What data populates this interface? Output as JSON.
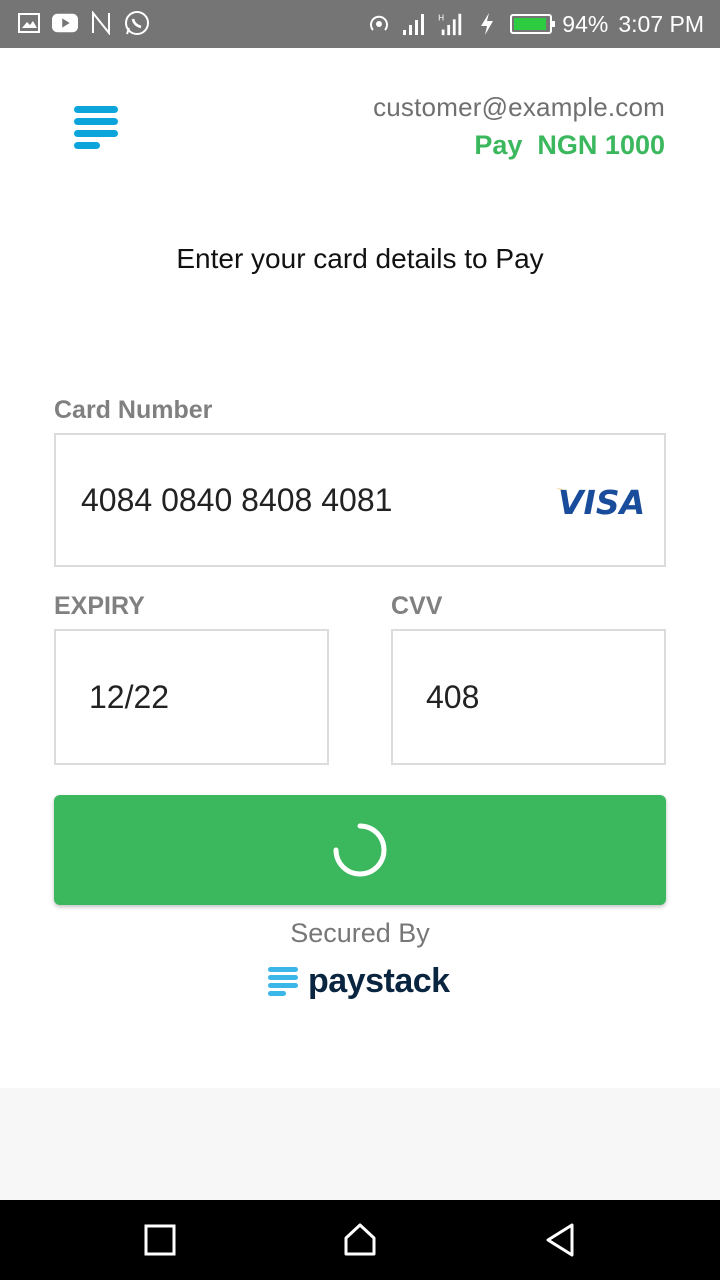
{
  "status_bar": {
    "left_icons": [
      "gallery-icon",
      "youtube-icon",
      "n-app-icon",
      "whatsapp-icon"
    ],
    "right_icons": [
      "hotspot-icon",
      "signal-icon",
      "data-signal-icon",
      "charging-icon"
    ],
    "battery_percent": "94%",
    "battery_level": 0.94,
    "time": "3:07 PM"
  },
  "header": {
    "email": "customer@example.com",
    "amount": "Pay  NGN 1000"
  },
  "instruction": "Enter your card details to Pay",
  "form": {
    "card_number_label": "Card Number",
    "card_number_value": "4084 0840 8408 4081",
    "card_brand": "VISA",
    "expiry_label": "EXPIRY",
    "expiry_value": "12/22",
    "cvv_label": "CVV",
    "cvv_value": "408"
  },
  "pay_button": {
    "state": "loading",
    "icon": "spinner-icon"
  },
  "footer": {
    "secured_by": "Secured By",
    "brand": "paystack"
  },
  "nav": {
    "buttons": [
      "recents-button",
      "home-button",
      "back-button"
    ]
  },
  "colors": {
    "accent_green": "#3bb75e",
    "brand_blue": "#0ba4db",
    "status_bar": "#757575"
  }
}
